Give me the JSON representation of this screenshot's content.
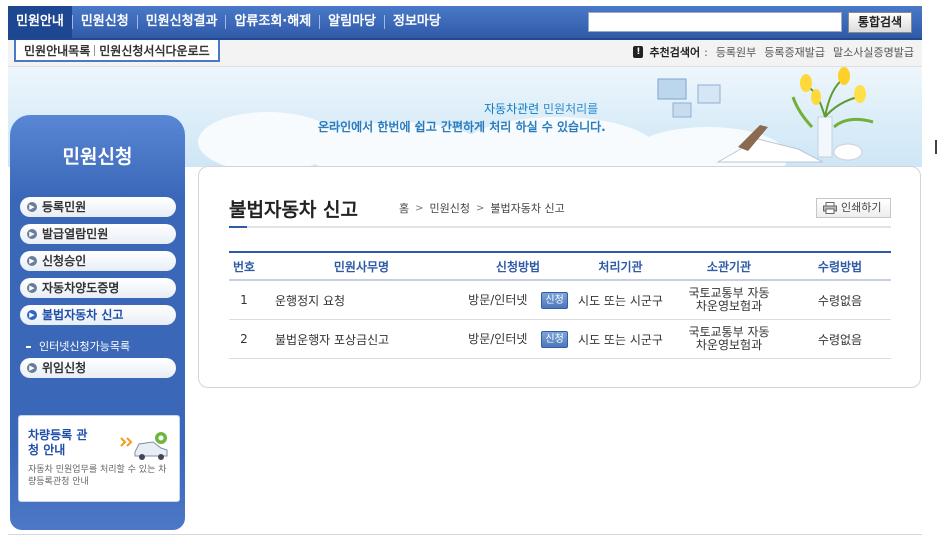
{
  "nav": {
    "items": [
      "민원안내",
      "민원신청",
      "민원신청결과",
      "압류조회·해제",
      "알림마당",
      "정보마당"
    ],
    "active_index": 0,
    "search_placeholder": "",
    "search_button": "통합검색"
  },
  "subnav": {
    "tabs": [
      "민원안내목록",
      "민원신청서식다운로드"
    ],
    "recommend_label": "추천검색어",
    "recommend_links": [
      "등록원부",
      "등록증재발급",
      "말소사실증명발급"
    ]
  },
  "banner": {
    "line1_highlight": "자동차관련",
    "line1_rest": " 민원처리를",
    "line2": "온라인에서 한번에 쉽고 간편하게 처리 하실 수 있습니다."
  },
  "sidebar": {
    "title": "민원신청",
    "items": [
      "등록민원",
      "발급열람민원",
      "신청승인",
      "자동차양도증명",
      "불법자동차 신고",
      "위임신청"
    ],
    "active_index": 4,
    "subitem": "인터넷신청가능목록",
    "promo": {
      "title": "차량등록 관청 안내",
      "desc": "자동차 민원업무를 처리할 수 있는 차량등록관청 안내"
    }
  },
  "content": {
    "title": "불법자동차 신고",
    "breadcrumb": [
      "홈",
      "민원신청",
      "불법자동차 신고"
    ],
    "print_label": "인쇄하기",
    "table": {
      "headers": [
        "번호",
        "민원사무명",
        "신청방법",
        "처리기관",
        "소관기관",
        "수령방법"
      ],
      "rows": [
        {
          "no": "1",
          "name": "운행정지 요청",
          "method": "방문/인터넷",
          "apply": "신청",
          "proc": "시도 또는 시군구",
          "agency1": "국토교통부 자동",
          "agency2": "차운영보험과",
          "receive": "수령없음"
        },
        {
          "no": "2",
          "name": "불법운행자 포상금신고",
          "method": "방문/인터넷",
          "apply": "신청",
          "proc": "시도 또는 시군구",
          "agency1": "국토교통부 자동",
          "agency2": "차운영보험과",
          "receive": "수령없음"
        }
      ]
    }
  }
}
